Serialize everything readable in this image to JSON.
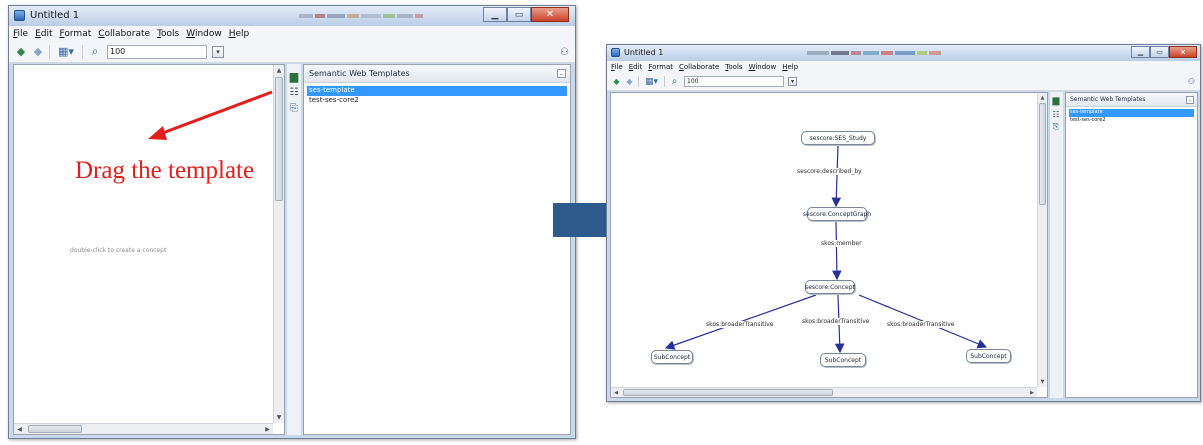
{
  "left_window": {
    "title": "Untitled 1",
    "menu": [
      "File",
      "Edit",
      "Format",
      "Collaborate",
      "Tools",
      "Window",
      "Help"
    ],
    "zoom_value": "100",
    "canvas_hint": "double-click to create a concept",
    "templates_panel": {
      "title": "Semantic Web Templates",
      "items": [
        {
          "label": "ses-template",
          "selected": true
        },
        {
          "label": "test-ses-core2",
          "selected": false
        }
      ]
    }
  },
  "annotation": {
    "text": "Drag the template",
    "color": "#e0201d"
  },
  "transition_arrow": {
    "color": "#2e5a8c",
    "icon": "right-arrow"
  },
  "right_window": {
    "title": "Untitled 1",
    "menu": [
      "File",
      "Edit",
      "Format",
      "Collaborate",
      "Tools",
      "Window",
      "Help"
    ],
    "zoom_value": "100",
    "templates_panel": {
      "title": "Semantic Web Templates",
      "items": [
        {
          "label": "ses-template",
          "selected": true
        },
        {
          "label": "test-ses-core2",
          "selected": false
        }
      ]
    },
    "concept_map": {
      "nodes": {
        "study": "sescore:SES_Study",
        "graph": "sescore:ConceptGraph",
        "concept": "sescore:Concept",
        "sub1": "SubConcept",
        "sub2": "SubConcept",
        "sub3": "SubConcept"
      },
      "links": {
        "described_by": "sescore:described_by",
        "member": "skos:member",
        "broader1": "skos:broaderTransitive",
        "broader2": "skos:broaderTransitive",
        "broader3": "skos:broaderTransitive"
      },
      "link_color": "#26309a"
    }
  },
  "colors": {
    "selection": "#3399ff",
    "title_gradient_top": "#e4edf8",
    "title_gradient_bottom": "#b9cde6"
  }
}
